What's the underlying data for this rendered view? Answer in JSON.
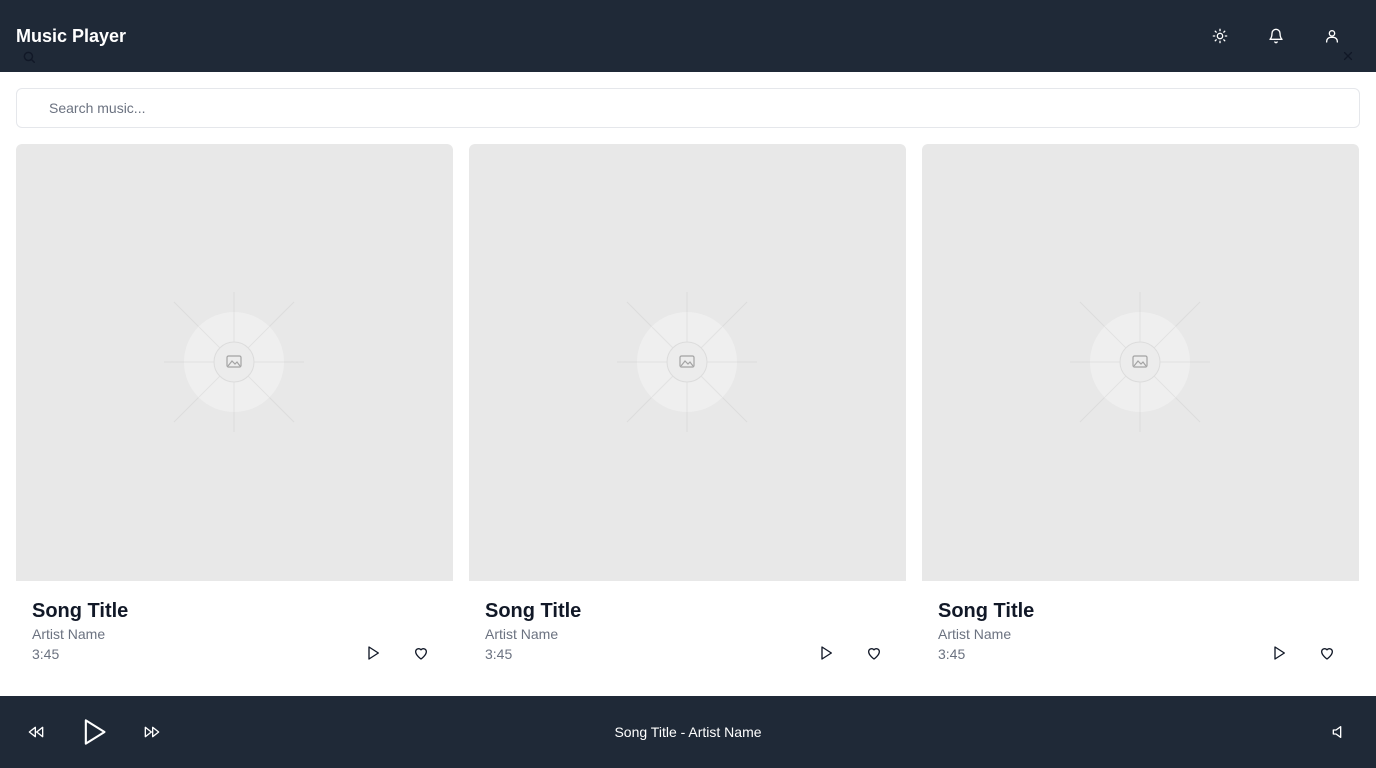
{
  "header": {
    "title": "Music Player",
    "actions": [
      "sun-icon",
      "bell-icon",
      "user-icon"
    ]
  },
  "search": {
    "placeholder": "Search music...",
    "value": ""
  },
  "songs": [
    {
      "title": "Song Title",
      "artist": "Artist Name",
      "duration": "3:45"
    },
    {
      "title": "Song Title",
      "artist": "Artist Name",
      "duration": "3:45"
    },
    {
      "title": "Song Title",
      "artist": "Artist Name",
      "duration": "3:45"
    }
  ],
  "player": {
    "now_playing": "Song Title - Artist Name"
  },
  "colors": {
    "header_bg": "#1f2937",
    "cover_bg": "#e8e8e8",
    "muted_text": "#6b7280"
  }
}
